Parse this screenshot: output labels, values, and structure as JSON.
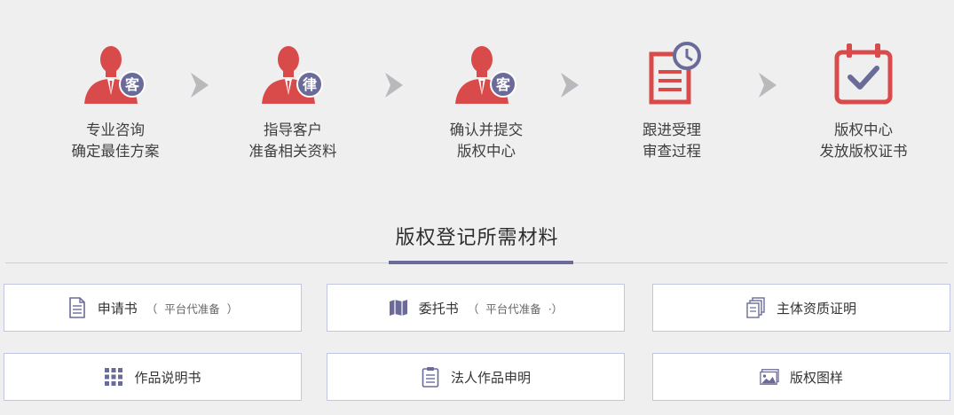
{
  "colors": {
    "accent_red": "#d94b4b",
    "accent_purple": "#6b6b9a",
    "arrow_gray": "#b9b9bd"
  },
  "steps": [
    {
      "icon": "consultant-person-icon",
      "badge": "客",
      "line1": "专业咨询",
      "line2": "确定最佳方案"
    },
    {
      "icon": "lawyer-person-icon",
      "badge": "律",
      "line1": "指导客户",
      "line2": "准备相关资料"
    },
    {
      "icon": "client-person-icon",
      "badge": "客",
      "line1": "确认并提交",
      "line2": "版权中心"
    },
    {
      "icon": "document-clock-icon",
      "line1": "跟进受理",
      "line2": "审查过程"
    },
    {
      "icon": "calendar-check-icon",
      "line1": "版权中心",
      "line2": "发放版权证书"
    }
  ],
  "section_title": "版权登记所需材料",
  "materials": [
    {
      "icon": "document-icon",
      "label": "申请书",
      "note": "（  平台代准备  ）"
    },
    {
      "icon": "map-icon",
      "label": "委托书",
      "note": "（  平台代准备  ·）"
    },
    {
      "icon": "copies-icon",
      "label": "主体资质证明"
    },
    {
      "icon": "grid-icon",
      "label": "作品说明书"
    },
    {
      "icon": "clipboard-icon",
      "label": "法人作品申明"
    },
    {
      "icon": "image-icon",
      "label": "版权图样"
    }
  ]
}
